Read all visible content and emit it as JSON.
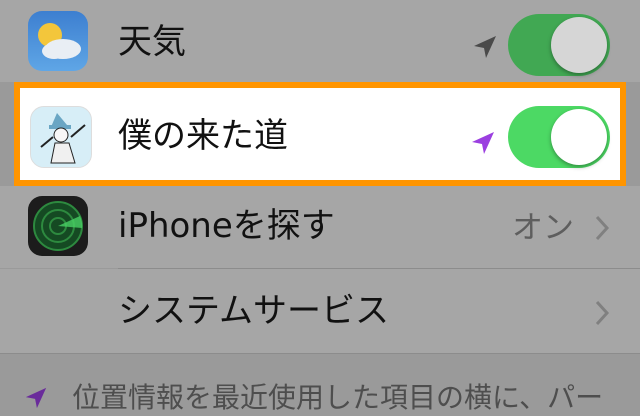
{
  "colors": {
    "toggle_on": "#4cd964",
    "toggle_on_dim": "#41a853",
    "highlight_border": "#ff9500",
    "location_arrow_recent": "#9b3fe0",
    "location_arrow_gray": "#4a4a4a"
  },
  "rows": [
    {
      "name": "weather",
      "label": "天気",
      "icon": "weather-app-icon",
      "location_icon": "location-arrow-gray-icon",
      "toggle_on": true
    },
    {
      "name": "bokunokitamichi",
      "label": "僕の来た道",
      "icon": "bokunokitamichi-app-icon",
      "location_icon": "location-arrow-purple-icon",
      "toggle_on": true
    },
    {
      "name": "find-my-iphone",
      "label": "iPhoneを探す",
      "icon": "find-my-iphone-radar-icon",
      "value": "オン"
    },
    {
      "name": "system-services",
      "label": "システムサービス"
    }
  ],
  "footer": {
    "text": "位置情報を最近使用した項目の横に、パー",
    "icon": "location-arrow-purple-icon"
  }
}
